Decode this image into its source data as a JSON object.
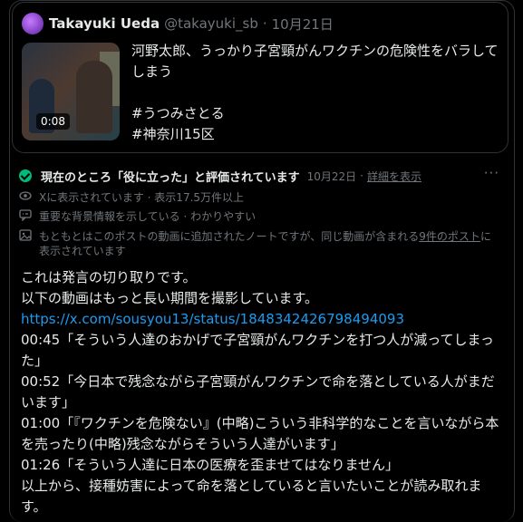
{
  "quoted_post": {
    "name": "Takayuki Ueda",
    "handle": "@takayuki_sb",
    "dot": "·",
    "date": "10月21日",
    "video_duration": "0:08",
    "text": "河野太郎、うっかり子宮頸がんワクチンの危険性をバラしてしまう\n\n#うつみさとる\n#神奈川15区"
  },
  "community_note": {
    "status": "現在のところ「役に立った」と評価されています",
    "date": "10月22日",
    "sep": "·",
    "details_link": "詳細を表示",
    "more": "···",
    "meta": [
      {
        "icon": "eye-icon",
        "text": "Xに表示されています · 表示17.5万件以上"
      },
      {
        "icon": "speech-bubble-icon",
        "text": "重要な背景情報を示している · わかりやすい"
      },
      {
        "icon": "image-icon",
        "text_before": "もともとはこのポストの動画に追加されたノートですが、同じ動画が含まれる",
        "link": "9件のポスト",
        "text_after": "に表示されています"
      }
    ]
  },
  "note_body": {
    "lines": [
      "これは発言の切り取りです。",
      "以下の動画はもっと長い期間を撮影しています。"
    ],
    "url": "https://x.com/sousyou13/status/1848342426798494093",
    "quotes": [
      "00:45「そういう人達のおかげで子宮頸がんワクチンを打つ人が減ってしまった」",
      "00:52「今日本で残念ながら子宮頸がんワクチンで命を落としている人がまだいます」",
      "01:00「『ワクチンを危険ない』(中略)こういう非科学的なことを言いながら本を売ったり(中略)残念ながらそういう人達がいます」",
      "01:26「そういう人達に日本の医療を歪ませてはなりません」",
      "以上から、接種妨害によって命を落としていると言いたいことが読み取れます。"
    ]
  },
  "colors": {
    "accent": "#1d9bf0",
    "success": "#00ba7c",
    "muted": "#71767b"
  }
}
